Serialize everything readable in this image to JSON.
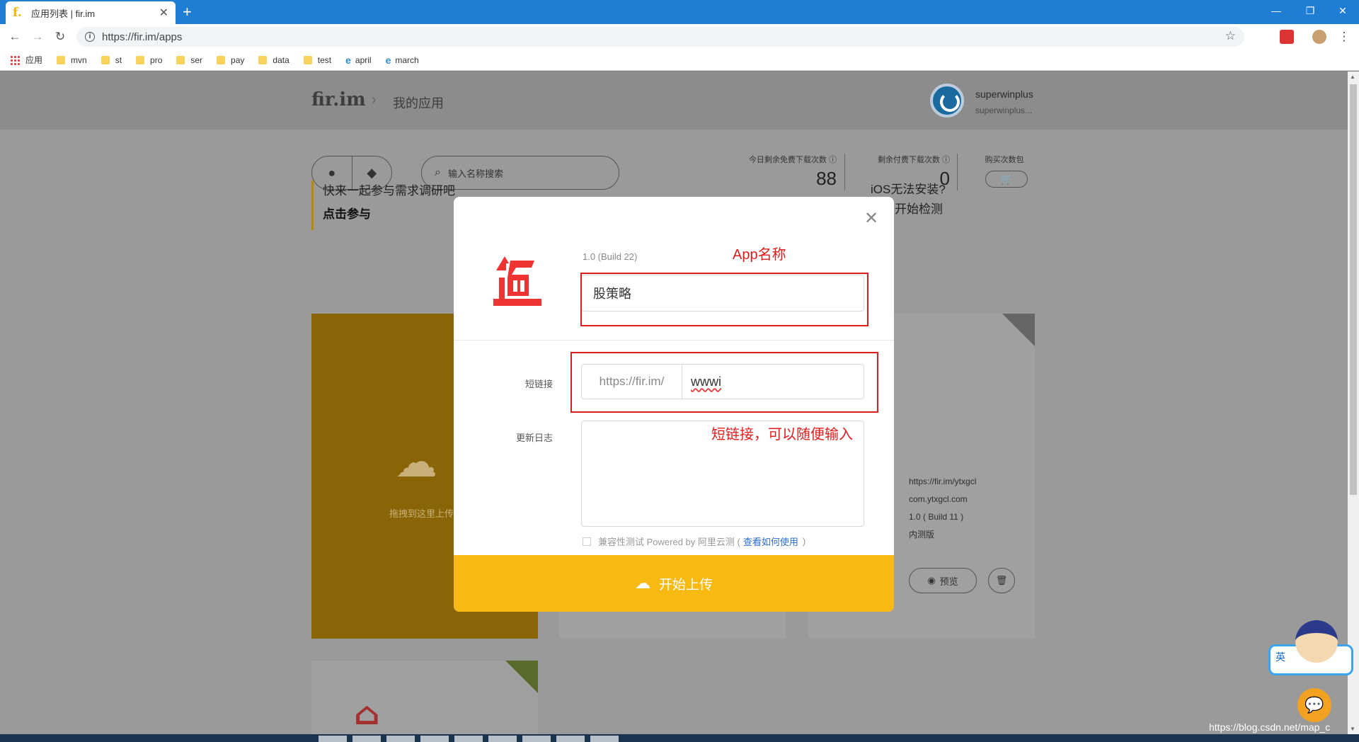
{
  "browser": {
    "tab_title": "应用列表 | fir.im",
    "tab_favicon": "f.",
    "new_tab": "+",
    "url": "https://fir.im/apps",
    "window_controls": [
      "—",
      "❐",
      "✕"
    ],
    "bookmarks": [
      {
        "label": "应用",
        "icon": "apps-grid-icon"
      },
      {
        "label": "mvn",
        "icon": "folder-icon"
      },
      {
        "label": "st",
        "icon": "folder-icon"
      },
      {
        "label": "pro",
        "icon": "folder-icon"
      },
      {
        "label": "ser",
        "icon": "folder-icon"
      },
      {
        "label": "pay",
        "icon": "folder-icon"
      },
      {
        "label": "data",
        "icon": "folder-icon"
      },
      {
        "label": "test",
        "icon": "folder-icon"
      },
      {
        "label": "april",
        "icon": "edge-icon"
      },
      {
        "label": "march",
        "icon": "edge-icon"
      }
    ]
  },
  "header": {
    "logo": "fir.im",
    "breadcrumb": "我的应用",
    "username": "superwinplus",
    "username_sub": "superwinplus..."
  },
  "toolbar": {
    "search_placeholder": "输入名称搜索",
    "stats": [
      {
        "label": "今日剩余免费下载次数 ⓘ",
        "value": "88"
      },
      {
        "label": "剩余付费下载次数 ⓘ",
        "value": "0"
      },
      {
        "label": "购买次数包",
        "value": ""
      }
    ]
  },
  "notice": {
    "line1": "快来一起参与需求调研吧",
    "line2": "点击参与",
    "right_line1": "iOS无法安装?",
    "right_line2": "点击开始检测"
  },
  "upload_area": {
    "text": "拖拽到这里上传"
  },
  "app_card": {
    "short_url": "https://fir.im/ytxgcl",
    "bundle_id": "com.ytxgcl.com",
    "version": "1.0 ( Build 11 )",
    "type": "内测版",
    "preview_label": "预览"
  },
  "modal": {
    "version": "1.0 (Build 22)",
    "app_name": "股策略",
    "shortlink_label": "短链接",
    "shortlink_prefix": "https://fir.im/",
    "shortlink_value": "wwwi",
    "changelog_label": "更新日志",
    "changelog_value": "",
    "compat_text": "兼容性测试 Powered by 阿里云测 (",
    "compat_link": "查看如何使用",
    "compat_end": ")",
    "upload_button": "开始上传"
  },
  "annotations": {
    "app_name_note": "App名称",
    "shortlink_note": "短链接，可以随便输入"
  },
  "watermark": "https://blog.csdn.net/map_c",
  "mascot_label": "英",
  "colors": {
    "accent": "#f8b912",
    "annotation": "#e41b1b",
    "chrome_blue": "#1e7ed4",
    "link": "#2a6dd0"
  }
}
